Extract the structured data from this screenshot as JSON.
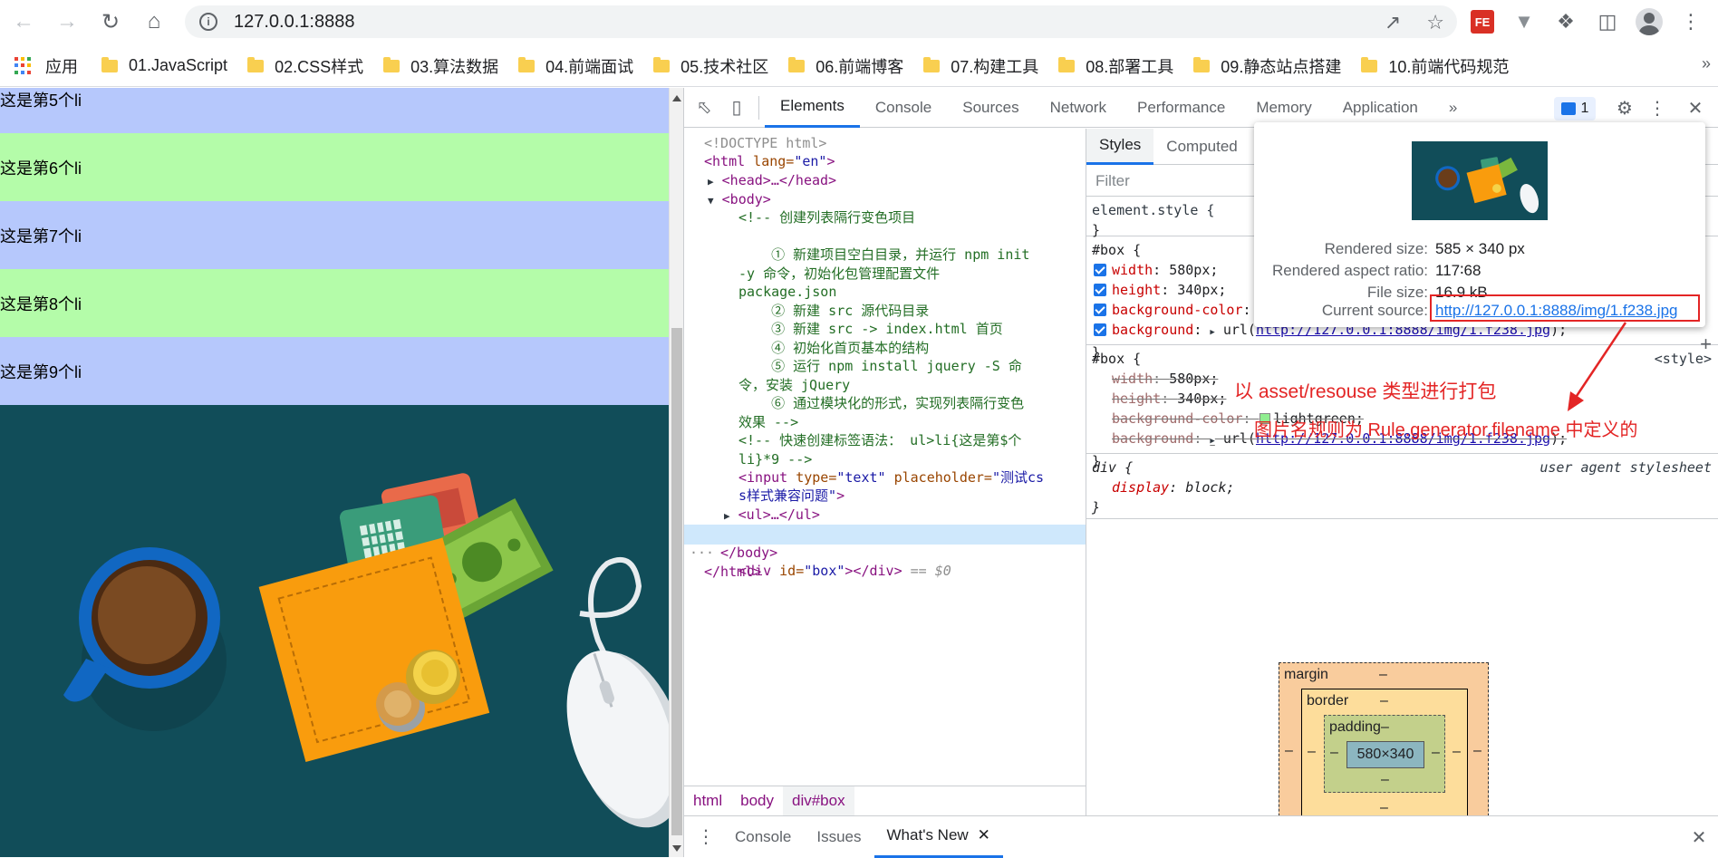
{
  "browser": {
    "url": "127.0.0.1:8888",
    "bookmarks_apps_label": "应用",
    "bookmarks": [
      "01.JavaScript",
      "02.CSS样式",
      "03.算法数据",
      "04.前端面试",
      "05.技术社区",
      "06.前端博客",
      "07.构建工具",
      "08.部署工具",
      "09.静态站点搭建",
      "10.前端代码规范"
    ],
    "extension_fe_label": "FE"
  },
  "page": {
    "list_items": [
      {
        "text": "这是第5个li",
        "color": "#b6c8fc"
      },
      {
        "text": "这是第6个li",
        "color": "#b4fca9"
      },
      {
        "text": "这是第7个li",
        "color": "#b6c8fc"
      },
      {
        "text": "这是第8个li",
        "color": "#b4fca9"
      },
      {
        "text": "这是第9个li",
        "color": "#b6c8fc"
      }
    ],
    "box_background": "#114d59"
  },
  "devtools": {
    "tabs": [
      "Elements",
      "Console",
      "Sources",
      "Network",
      "Performance",
      "Memory",
      "Application"
    ],
    "active_tab": "Elements",
    "more_tabs": "»",
    "issues_count": "1",
    "elements": {
      "doctype": "<!DOCTYPE html>",
      "html_open_tag": "<html",
      "html_lang_attr": " lang=",
      "html_lang_val": "\"en\"",
      "html_open_close": ">",
      "head": "<head>…</head>",
      "body_open": "<body>",
      "comment_lines": [
        "<!-- 创建列表隔行变色项目",
        "",
        "    ① 新建项目空白目录，并运行 npm init",
        "-y 命令，初始化包管理配置文件",
        "package.json",
        "    ② 新建 src 源代码目录",
        "    ③ 新建 src -> index.html 首页",
        "    ④ 初始化首页基本的结构",
        "    ⑤ 运行 npm install jquery -S 命",
        "令，安装 jQuery",
        "    ⑥ 通过模块化的形式，实现列表隔行变色",
        "效果 -->"
      ],
      "comment2_lines": [
        "<!-- 快速创建标签语法： ul>li{这是第$个",
        "li}*9 -->"
      ],
      "input_line1_tag": "<input",
      "input_line1_attr1": " type=",
      "input_line1_val1": "\"text\"",
      "input_line1_attr2": " placeholder=",
      "input_line1_val2": "\"测试cs",
      "input_line2_val": "s样式兼容问题\"",
      "input_line2_close": ">",
      "ul": "<ul>…</ul>",
      "div_tag": "<div",
      "div_attr": " id=",
      "div_val": "\"box\"",
      "div_close": "></div>",
      "div_suffix": " == $0",
      "body_close": "</body>",
      "html_close": "</html>",
      "dots": "···"
    },
    "breadcrumbs": [
      "html",
      "body",
      "div#box"
    ],
    "styles": {
      "tabs": [
        "Styles",
        "Computed"
      ],
      "filter_placeholder": "Filter",
      "element_style_selector": "element.style {",
      "close_brace": "}",
      "rule1": {
        "selector": "#box {",
        "props": [
          {
            "name": "width",
            "value": "580px;"
          },
          {
            "name": "height",
            "value": "340px;"
          },
          {
            "name": "background-color",
            "value": "lightgreen;"
          },
          {
            "name": "background",
            "value": "url(",
            "link": "http://127.0.0.1:8888/img/1.f238.jpg",
            "suffix": ");"
          }
        ]
      },
      "rule2": {
        "selector": "#box {",
        "source": "<style>",
        "props": [
          {
            "name": "width",
            "value": "580px;"
          },
          {
            "name": "height",
            "value": "340px;"
          },
          {
            "name": "background-color",
            "value": "lightgreen;"
          },
          {
            "name": "background",
            "value": "url(",
            "link": "http://127.0.0.1:8888/img/1.f238.jpg",
            "suffix": ");"
          }
        ]
      },
      "rule3": {
        "selector": "div {",
        "source": "user agent stylesheet",
        "props": [
          {
            "name": "display",
            "value": "block;"
          }
        ]
      },
      "box_model": {
        "margin_label": "margin",
        "border_label": "border",
        "padding_label": "padding",
        "content": "580×340",
        "dash": "–"
      }
    },
    "drawer_tabs": [
      "Console",
      "Issues",
      "What's New"
    ],
    "tooltip": {
      "rendered_size_key": "Rendered size:",
      "rendered_size_val": "585 × 340 px",
      "aspect_key": "Rendered aspect ratio:",
      "aspect_val": "117∶68",
      "filesize_key": "File size:",
      "filesize_val": "16.9 kB",
      "source_key": "Current source:",
      "source_val": "http://127.0.0.1:8888/img/1.f238.jpg"
    }
  },
  "annotations": {
    "line1": "以 asset/resouse 类型进行打包",
    "line2": "图片名规则为 Rule.generator.filename 中定义的",
    "color": "#e32525"
  }
}
